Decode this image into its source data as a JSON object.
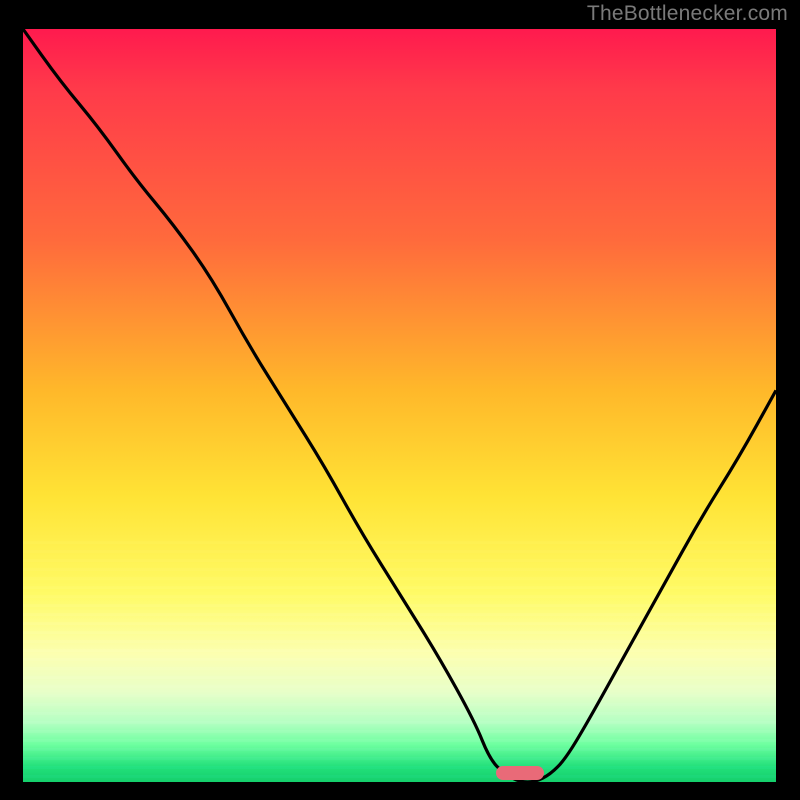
{
  "attribution": "TheBottlenecker.com",
  "chart_data": {
    "type": "line",
    "title": "",
    "xlabel": "",
    "ylabel": "",
    "xlim": [
      0,
      100
    ],
    "ylim": [
      0,
      100
    ],
    "x": [
      0,
      5,
      10,
      15,
      20,
      25,
      30,
      35,
      40,
      45,
      50,
      55,
      60,
      62,
      64,
      66,
      68,
      70,
      72,
      75,
      80,
      85,
      90,
      95,
      100
    ],
    "values": [
      100,
      93,
      87,
      80,
      74,
      67,
      58,
      50,
      42,
      33,
      25,
      17,
      8,
      3,
      1,
      0,
      0,
      1,
      3,
      8,
      17,
      26,
      35,
      43,
      52
    ],
    "marker_x": 66,
    "annotations": []
  },
  "colors": {
    "curve": "#000000",
    "marker": "#e96a78",
    "frame_bg": "#000000"
  }
}
